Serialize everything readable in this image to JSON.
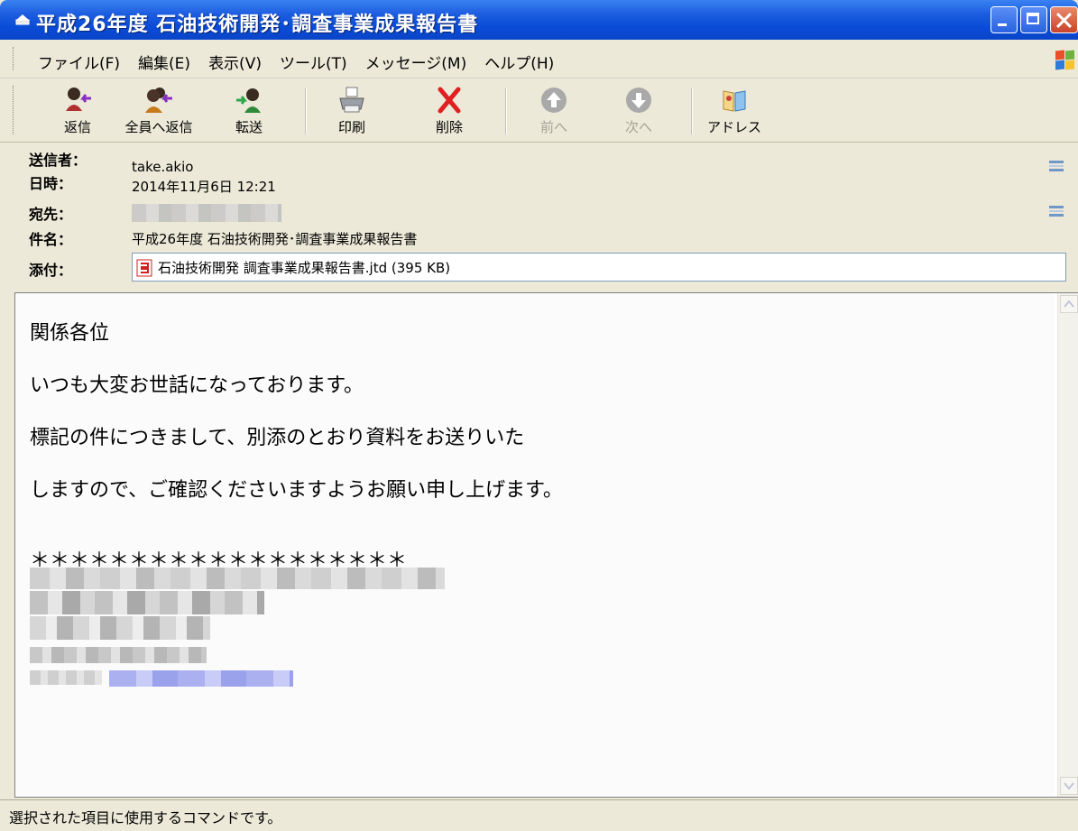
{
  "window": {
    "title": "平成26年度 石油技術開発･調査事業成果報告書"
  },
  "menu": [
    {
      "label": "ファイル(F)"
    },
    {
      "label": "編集(E)"
    },
    {
      "label": "表示(V)"
    },
    {
      "label": "ツール(T)"
    },
    {
      "label": "メッセージ(M)"
    },
    {
      "label": "ヘルプ(H)"
    }
  ],
  "toolbar": {
    "reply": "返信",
    "reply_all": "全員へ返信",
    "forward": "転送",
    "print": "印刷",
    "delete": "削除",
    "prev": "前へ",
    "next": "次へ",
    "address": "アドレス"
  },
  "header": {
    "from_label": "送信者：",
    "from_value": "take.akio",
    "date_label": "日時：",
    "date_value": "2014年11月6日 12:21",
    "to_label": "宛先：",
    "subject_label": "件名：",
    "subject_value": "平成26年度 石油技術開発･調査事業成果報告書",
    "attach_label": "添付：",
    "attachment": "石油技術開発 調査事業成果報告書.jtd (395 KB)"
  },
  "body": {
    "lines": [
      "関係各位",
      "いつも大変お世話になっております。",
      "標記の件につきまして、別添のとおり資料をお送りいた",
      "しますので、ご確認くださいますようお願い申し上げます。",
      "＊＊＊＊＊＊＊＊＊＊＊＊＊＊＊＊＊＊＊"
    ]
  },
  "status": {
    "text": "選択された項目に使用するコマンドです。"
  },
  "colors": {
    "titlebar": "#0a4bd6",
    "chrome": "#ece9d8",
    "link_blur": "#aab0f0"
  },
  "icons": [
    "window-mail-icon",
    "reply-icon",
    "reply-all-icon",
    "forward-icon",
    "print-icon",
    "delete-icon",
    "prev-icon",
    "next-icon",
    "address-book-icon",
    "windows-logo-icon",
    "attachment-file-icon",
    "collapse-icon"
  ]
}
